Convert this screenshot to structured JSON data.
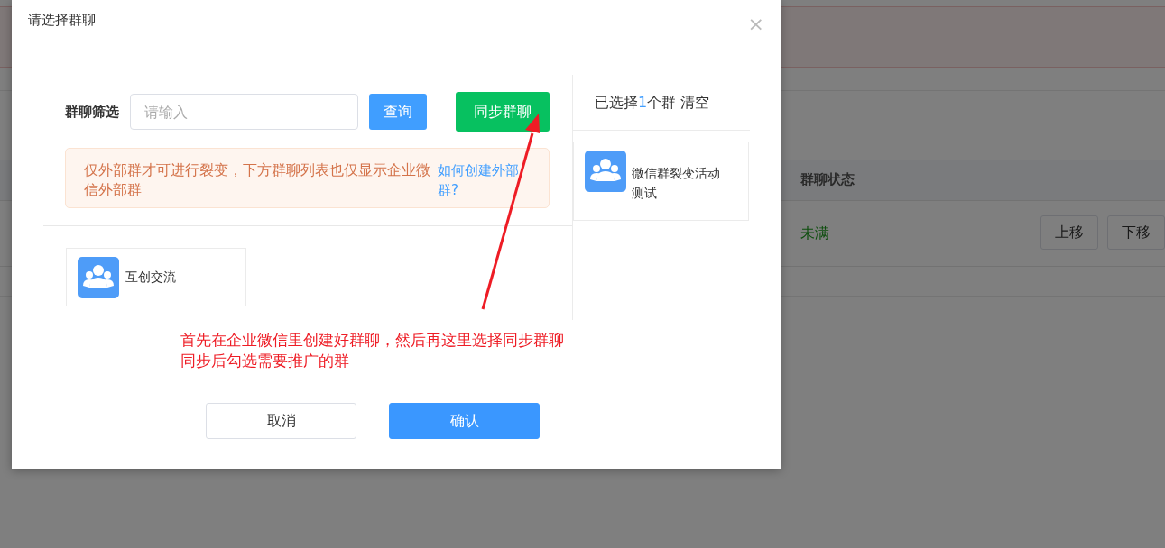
{
  "background_page": {
    "table": {
      "column_header": "群聊状态",
      "row": {
        "status": "未满",
        "buttons": [
          "上移",
          "下移"
        ]
      }
    }
  },
  "dialog": {
    "title": "请选择群聊",
    "close": "×",
    "filter": {
      "label": "群聊筛选",
      "placeholder": "请输入",
      "search_button": "查询",
      "sync_button": "同步群聊"
    },
    "notice": {
      "text": "仅外部群才可进行裂变，下方群聊列表也仅显示企业微信外部群",
      "link": "如何创建外部群?"
    },
    "groups": [
      {
        "name": "互创交流"
      }
    ],
    "selected_panel": {
      "prefix": "已选择",
      "count": "1",
      "suffix": "个群",
      "clear": "清空",
      "groups": [
        {
          "name": "微信群裂变活动测试"
        }
      ]
    },
    "buttons": [
      {
        "label": "取消",
        "kind": "default"
      },
      {
        "label": "确认",
        "kind": "primary"
      }
    ]
  },
  "annotation": {
    "lines": [
      "首先在企业微信里创建好群聊，然后再这里选择同步群聊",
      "同步后勾选需要推广的群"
    ]
  }
}
